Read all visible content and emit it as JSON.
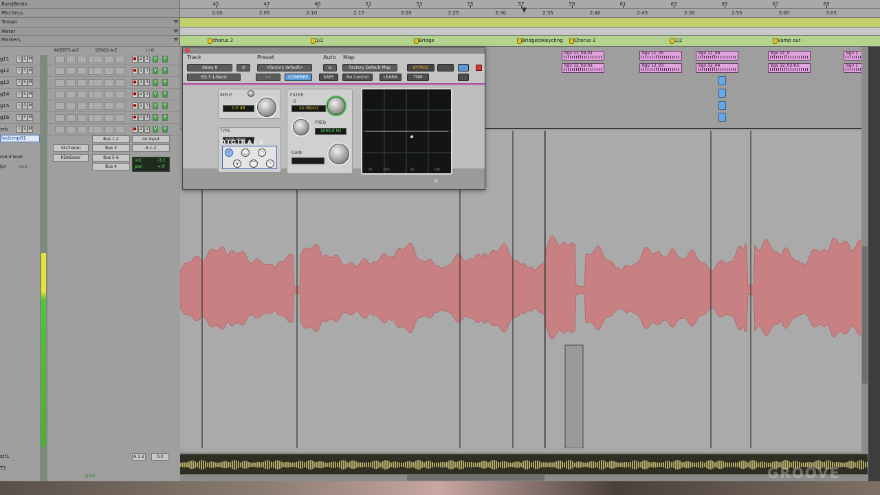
{
  "rulers": {
    "labels": [
      "Bars|Beats",
      "Min:Secs",
      "Tempo",
      "Meter",
      "Markers"
    ],
    "bars": [
      "45",
      "47",
      "49",
      "51",
      "53",
      "55",
      "57",
      "59",
      "61",
      "63",
      "65",
      "67",
      "69"
    ],
    "times": [
      "2:00",
      "2:05",
      "2:10",
      "2:15",
      "2:20",
      "2:25",
      "2:30",
      "2:35",
      "2:40",
      "2:45",
      "2:50",
      "2:55",
      "3:00",
      "3:05"
    ],
    "markers": [
      "chorus 2",
      "1/2",
      "Bridge",
      "BridgetoKeychng",
      "Chorus 3",
      "1/2",
      "Vamp out"
    ]
  },
  "mixer": {
    "col_inserts": "INSERTS A-E",
    "col_sends": "SENDS A-E",
    "col_io": "I / O",
    "tracks": [
      {
        "name": "g11"
      },
      {
        "name": "g12"
      },
      {
        "name": "g13"
      },
      {
        "name": "g14"
      },
      {
        "name": "g15"
      },
      {
        "name": "g16"
      },
      {
        "name": "vrb"
      }
    ],
    "selected_track": "lvclcmp01",
    "selected_sub1": "snd d level",
    "selected_sub2": "lyn",
    "selected_sub2_val": "read",
    "inserts": [
      "SLChanel",
      "RDeEsser"
    ],
    "sends": [
      "Bus 1-2",
      "Bus 3",
      "Bus 5-6",
      "Bus 4"
    ],
    "io_in": "no input",
    "io_out": "A 1-2",
    "vol_label": "vol",
    "vol_value": "-3.1",
    "pan_label": "pan",
    "pan_value": "< 0",
    "bottom_track1": "str1",
    "bottom_track2": "TS",
    "bottom_io": "A 1-2",
    "bottom_val": "0.0",
    "transport_status": "play"
  },
  "clips_upper": [
    "bgv 11_04-01",
    "bgv 11_05",
    "bgv 11_06",
    "bgv 11_0",
    "bgv 1",
    "bgv 12_02-01",
    "bgv 12_03",
    "bgv 12_04",
    "bgv 12_02-05",
    "bgv 1"
  ],
  "plugin": {
    "header": {
      "track_label": "Track",
      "preset_label": "Preset",
      "auto_label": "Auto",
      "map_label": "Map",
      "track_name": "delay 8",
      "track_suffix": "d",
      "preset_name": "<factory default>",
      "map_name": "Factory Default Map",
      "plugin_name": "EQ 3 1-Band",
      "compare": "COMPARE",
      "safe": "SAFE",
      "no_control": "No Control",
      "learn": "LEARN",
      "tdm": "TDM",
      "bypass": "BYPASS"
    },
    "input_label": "INPUT",
    "input_value": "0.0 dB",
    "type_label": "TYPE",
    "type_value": "High-Pass",
    "filter_label": "FILTER",
    "filter_q_label": "Q",
    "filter_slope": "24 dB/oct",
    "freq_label": "FREQ",
    "freq_value": "1000.0 Hz",
    "gain_label": "GAIN",
    "brand": "DIGIRACK",
    "graph_axis": [
      "20",
      "100",
      "1k",
      "10k"
    ]
  },
  "watermark": "GROOVE"
}
